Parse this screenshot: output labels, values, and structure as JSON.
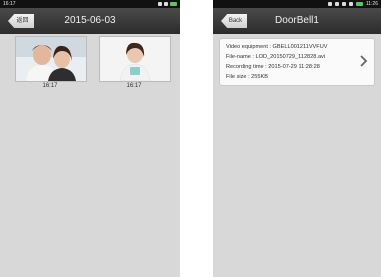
{
  "left_screen": {
    "status": {
      "time": "16:17"
    },
    "header": {
      "back_label": "返回",
      "title": "2015-06-03"
    },
    "photos": [
      {
        "time": "16:17"
      },
      {
        "time": "16:17"
      }
    ]
  },
  "right_screen": {
    "status": {
      "time": "11:26"
    },
    "header": {
      "back_label": "Back",
      "title": "DoorBell1"
    },
    "record": {
      "video_equipment": "Video equipment :   GBELL001211VVFUV",
      "file_name": "File-name :   LOD_20150729_112828.avi",
      "recording_time": "Recording time :   2015-07-29  11:28:28",
      "file_size": "File size :   255KB"
    }
  },
  "colors": {
    "background": "#d8d8d8",
    "title_bar": "#3a3a3a",
    "status_bar": "#111111",
    "card": "#fafafa"
  }
}
